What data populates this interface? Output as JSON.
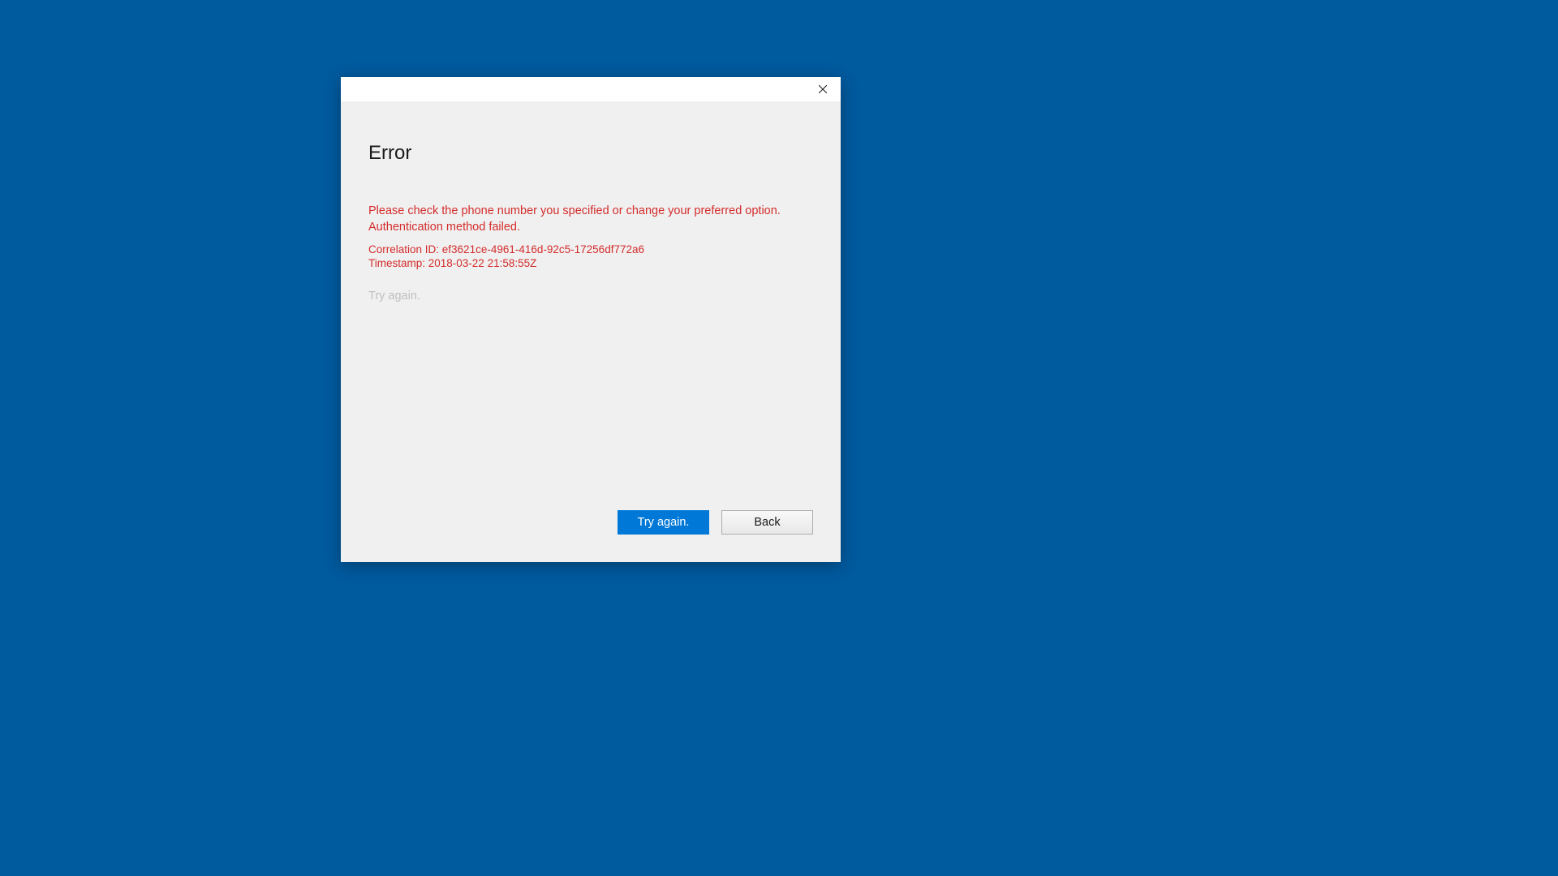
{
  "dialog": {
    "title": "Error",
    "error_message": "Please check the phone number you specified or change your preferred option. Authentication method failed.",
    "correlation_id_line": "Correlation ID: ef3621ce-4961-416d-92c5-17256df772a6",
    "timestamp_line": "Timestamp: 2018-03-22 21:58:55Z",
    "hint": "Try again.",
    "buttons": {
      "primary": "Try again.",
      "secondary": "Back"
    }
  }
}
